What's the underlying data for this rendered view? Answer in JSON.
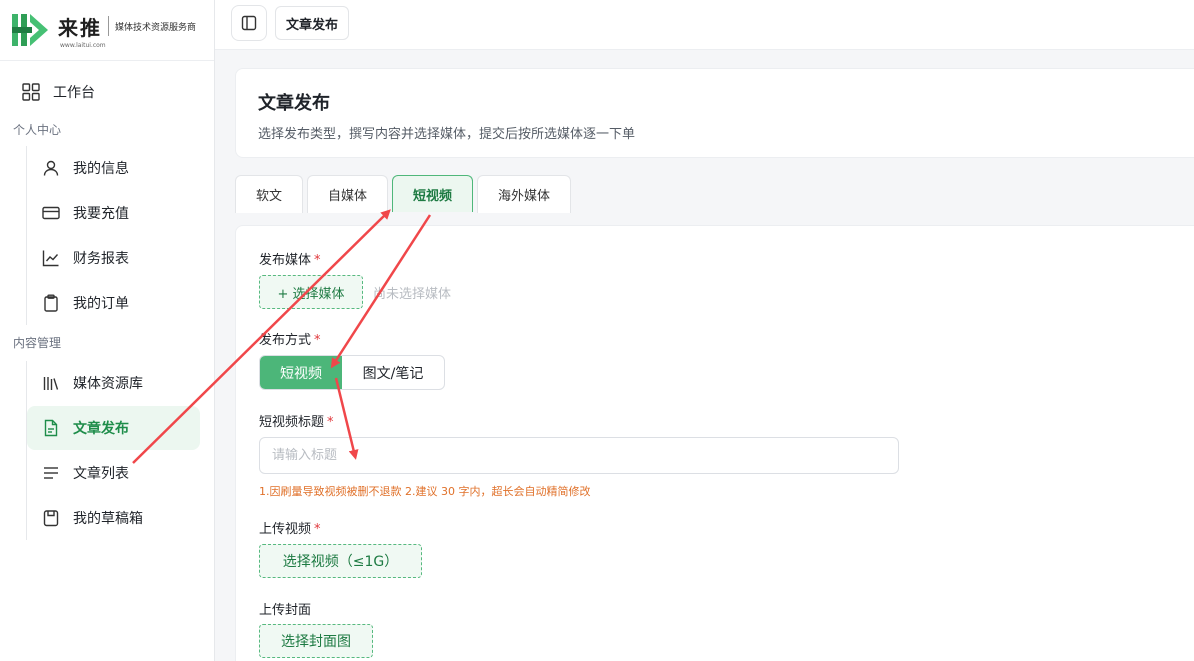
{
  "brand": {
    "name": "来推",
    "slogan": "媒体技术资源服务商",
    "url": "www.laitui.com",
    "color": "#2fa05a"
  },
  "sidebar": {
    "workbench": "工作台",
    "personal_section": "个人中心",
    "personal_items": [
      {
        "label": "我的信息",
        "icon": "user-icon"
      },
      {
        "label": "我要充值",
        "icon": "credit-card-icon"
      },
      {
        "label": "财务报表",
        "icon": "line-chart-icon"
      },
      {
        "label": "我的订单",
        "icon": "clipboard-icon"
      }
    ],
    "content_section": "内容管理",
    "content_items": [
      {
        "label": "媒体资源库",
        "icon": "library-icon"
      },
      {
        "label": "文章发布",
        "icon": "file-text-icon",
        "active": true
      },
      {
        "label": "文章列表",
        "icon": "list-icon"
      },
      {
        "label": "我的草稿箱",
        "icon": "draft-icon"
      }
    ]
  },
  "topbar": {
    "breadcrumb": "文章发布"
  },
  "header": {
    "title": "文章发布",
    "subtitle": "选择发布类型，撰写内容并选择媒体，提交后按所选媒体逐一下单"
  },
  "tabs": [
    {
      "label": "软文",
      "active": false
    },
    {
      "label": "自媒体",
      "active": false
    },
    {
      "label": "短视频",
      "active": true
    },
    {
      "label": "海外媒体",
      "active": false
    }
  ],
  "form": {
    "media_label": "发布媒体",
    "media_button": "+ 选择媒体",
    "media_hint": "尚未选择媒体",
    "method_label": "发布方式",
    "method_options": [
      "短视频",
      "图文/笔记"
    ],
    "title_label": "短视频标题",
    "title_placeholder": "请输入标题",
    "title_warning": "1.因刷量导致视频被删不退款 2.建议 30 字内，超长会自动精简修改",
    "video_label": "上传视频",
    "video_button": "选择视频（≤1G）",
    "cover_label": "上传封面",
    "cover_button": "选择封面图",
    "required_mark": "*"
  },
  "colors": {
    "accent": "#4cb679",
    "active_bg": "#ecf7f0",
    "warning": "#e0712a",
    "required": "#e0363b",
    "annotation_arrow": "#f0474a"
  }
}
